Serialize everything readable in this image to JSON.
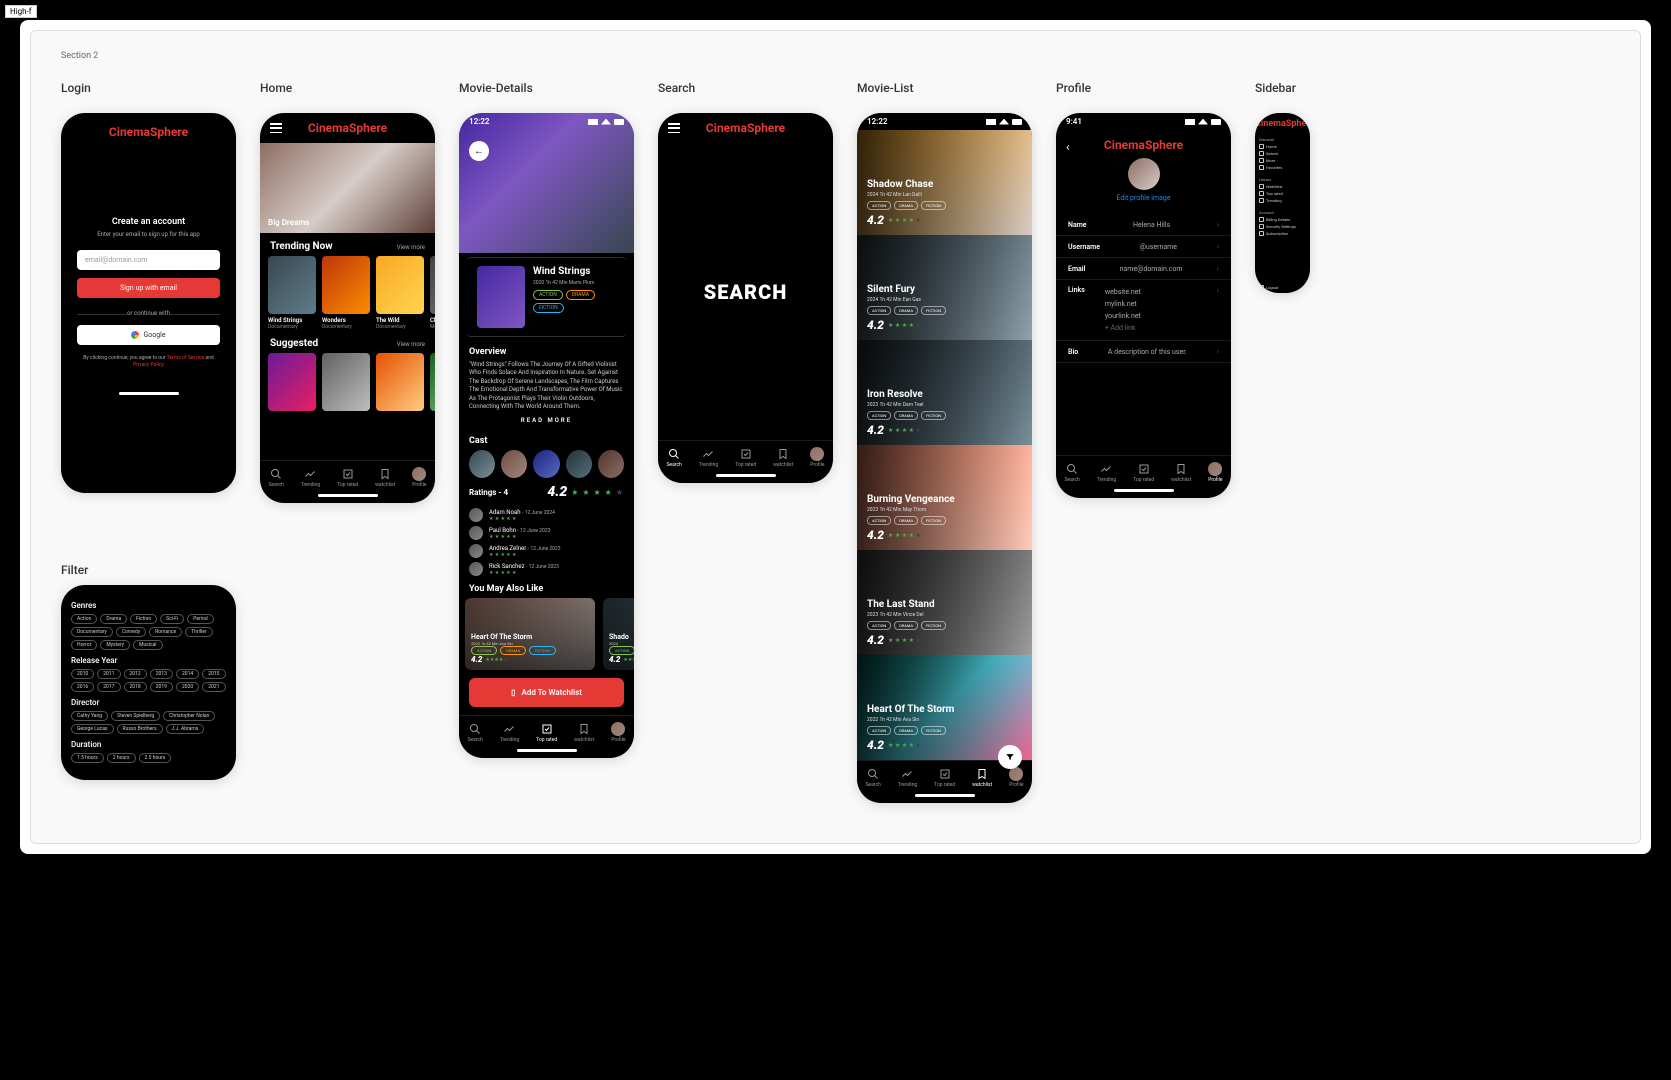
{
  "badge": "High-f",
  "section_label": "Section 2",
  "app_name": "CinemaSphere",
  "titles": {
    "login": "Login",
    "home": "Home",
    "details": "Movie-Details",
    "search": "Search",
    "list": "Movie-List",
    "profile": "Profile",
    "sidebar": "Sidebar",
    "filter": "Filter"
  },
  "login": {
    "heading": "Create an account",
    "sub": "Enter your email to sign up for this app",
    "placeholder": "email@domain.com",
    "signup_btn": "Sign up with email",
    "or": "or continue with",
    "google": "Google",
    "legal1": "By clicking continue, you agree to our ",
    "tos": "Terms of Service",
    "legal2": " and ",
    "privacy": "Privacy Policy"
  },
  "home": {
    "hero": "Big Dreams",
    "trending": "Trending Now",
    "suggested": "Suggested",
    "view_more": "View more",
    "items": [
      {
        "t": "Wind Strings",
        "s": "Documentary"
      },
      {
        "t": "Wonders",
        "s": "Documentary"
      },
      {
        "t": "The Wild",
        "s": "Documentary"
      },
      {
        "t": "Close",
        "s": "Mo"
      }
    ]
  },
  "nav": [
    "Search",
    "Trending",
    "Top rated",
    "watchlist",
    "Profile"
  ],
  "details": {
    "time": "12:22",
    "title": "Wind Strings",
    "meta": "2020    1h 42 Min    Mario Plum",
    "genres": [
      "ACTION",
      "DRAMA",
      "FICTION"
    ],
    "overview_h": "Overview",
    "overview": "\"Wind Strings\" Follows The Journey Of A Gifted Violinist Who Finds Solace And Inspiration In Nature. Set Against The Backdrop Of Serene Landscapes, The Film Captures The Emotional Depth And Transformative Power Of Music As The Protagonist Plays Their Violin Outdoors, Connecting With The World Around Them.",
    "read_more": "READ MORE",
    "cast_h": "Cast",
    "ratings_h": "Ratings  -  4",
    "rating": "4.2",
    "reviews": [
      {
        "name": "Adam Noah",
        "date": "12 June 2024"
      },
      {
        "name": "Paul Bohn",
        "date": "12 June 2023"
      },
      {
        "name": "Andrea Zelner",
        "date": "12 June 2023"
      },
      {
        "name": "Rick Sanchez",
        "date": "12 June 2023"
      }
    ],
    "ymayl_h": "You May Also Like",
    "recs": [
      {
        "t": "Heart Of The Storm",
        "y": "2022",
        "d": "1h 42 Min",
        "a": "Ava Sin",
        "r": "4.2"
      },
      {
        "t": "Shado",
        "y": "2024",
        "r": "4.2"
      }
    ],
    "add_btn": "Add To Watchlist"
  },
  "search": {
    "big": "SEARCH"
  },
  "list": {
    "time": "12:22",
    "items": [
      {
        "t": "Shadow Chase",
        "y": "2024",
        "d": "1h 42 Min",
        "a": "Lan Dalli",
        "r": "4.2"
      },
      {
        "t": "Silent Fury",
        "y": "2024",
        "d": "1h 42 Min",
        "a": "Ean Gas",
        "r": "4.2"
      },
      {
        "t": "Iron Resolve",
        "y": "2023",
        "d": "1h 42 Min",
        "a": "Dam Teel",
        "r": "4.2"
      },
      {
        "t": "Burning Vengeance",
        "y": "2023",
        "d": "1h 42 Min",
        "a": "May Thom",
        "r": "4.2"
      },
      {
        "t": "The Last Stand",
        "y": "2023",
        "d": "1h 42 Min",
        "a": "Vince Del",
        "r": "4.2"
      },
      {
        "t": "Heart Of The Storm",
        "y": "2022",
        "d": "1h 42 Min",
        "a": "Ava Sin",
        "r": "4.2"
      }
    ],
    "genres": [
      "ACTION",
      "DRAMA",
      "FICTION"
    ]
  },
  "profile": {
    "time": "9:41",
    "edit": "Edit profile image",
    "rows": [
      {
        "l": "Name",
        "v": "Helena Hills"
      },
      {
        "l": "Username",
        "v": "@username"
      },
      {
        "l": "Email",
        "v": "name@domain.com"
      }
    ],
    "links_l": "Links",
    "links": [
      "website.net",
      "mylink.net",
      "yourlink.net"
    ],
    "add_link": "+ Add link",
    "bio_l": "Bio",
    "bio_v": "A description of this user."
  },
  "sidebar": {
    "sections": [
      {
        "h": "Discover",
        "items": [
          "Home",
          "Search",
          "More",
          "Favorites"
        ]
      },
      {
        "h": "Library",
        "items": [
          "Watchlist",
          "Top rated",
          "Trending"
        ]
      },
      {
        "h": "Account",
        "items": [
          "Billing Details",
          "Security Settings",
          "Subscription"
        ]
      }
    ],
    "logout": "Logout"
  },
  "filter": {
    "genres_h": "Genres",
    "genres": [
      "Action",
      "Drama",
      "Fiction",
      "Sci-Fi",
      "Period",
      "Documentary",
      "Comedy",
      "Romance",
      "Thriller",
      "Horror",
      "Mystery",
      "Musical"
    ],
    "year_h": "Release Year",
    "years": [
      "2010",
      "2011",
      "2012",
      "2013",
      "2014",
      "2015",
      "2016",
      "2017",
      "2018",
      "2019",
      "2020",
      "2021"
    ],
    "director_h": "Director",
    "directors": [
      "Cathy Yang",
      "Steven Spielberg",
      "Christopher Nolan",
      "George Lucas",
      "Russo Brothers",
      "J.J. Abrams"
    ],
    "duration_h": "Duration",
    "durations": [
      "1.5 hours",
      "2 hours",
      "2.5 hours"
    ]
  }
}
